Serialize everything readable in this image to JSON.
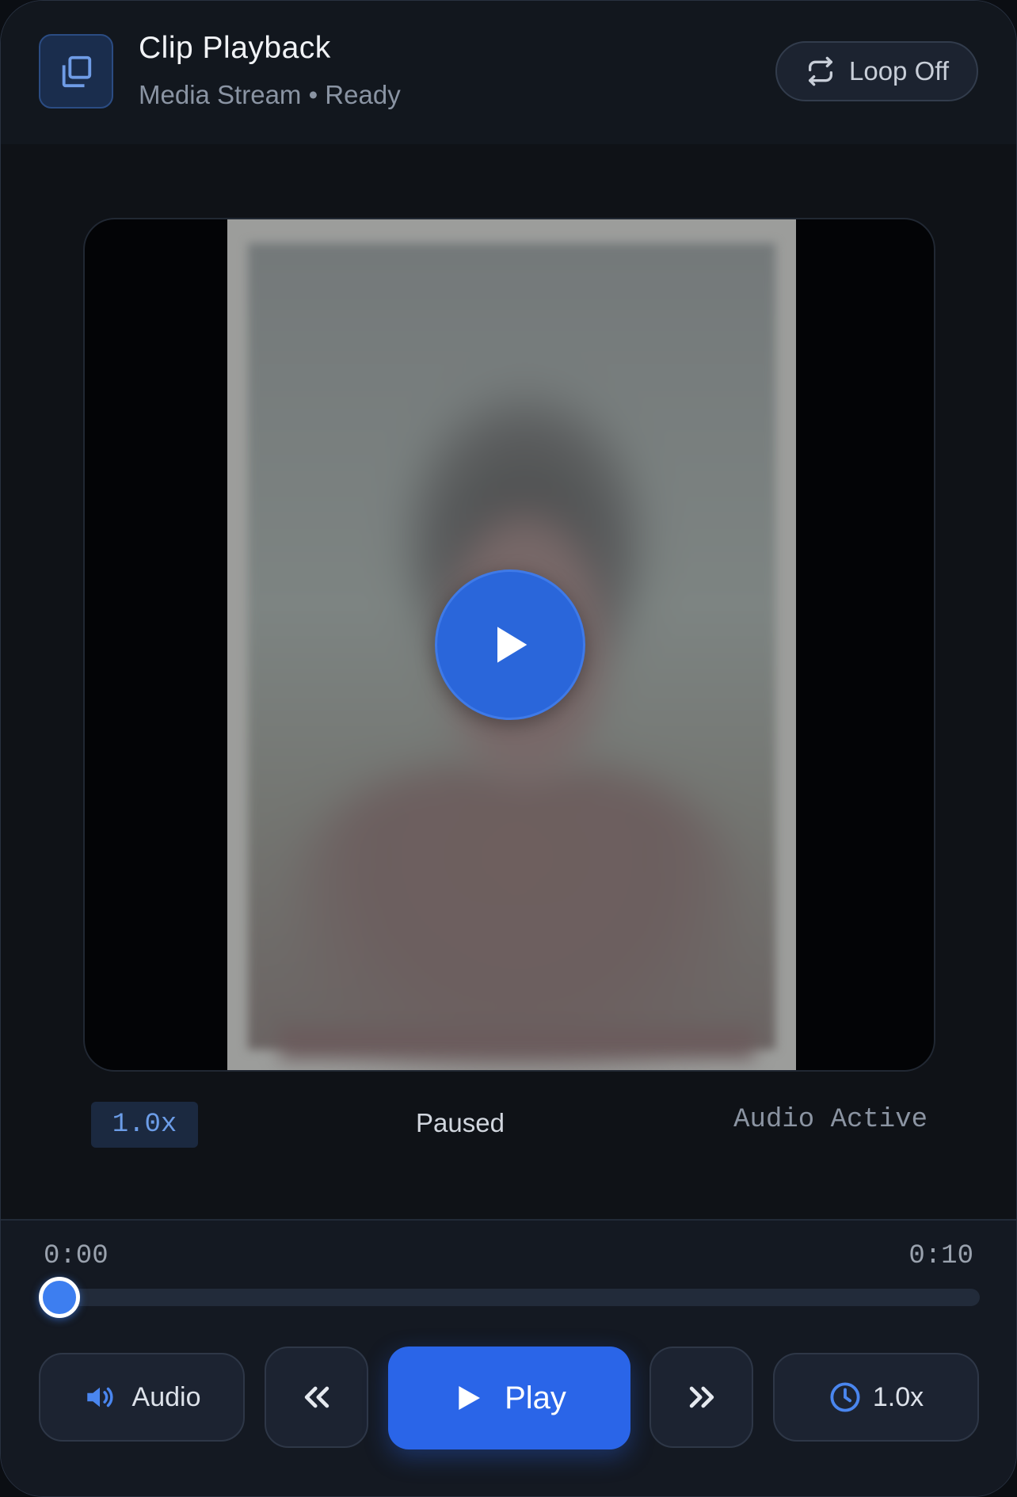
{
  "header": {
    "title": "Clip Playback",
    "subtitle": "Media Stream • Ready",
    "loop_label": "Loop Off"
  },
  "status": {
    "speed": "1.0x",
    "state": "Paused",
    "audio": "Audio Active"
  },
  "timeline": {
    "current": "0:00",
    "duration": "0:10",
    "progress": 0
  },
  "controls": {
    "audio_label": "Audio",
    "play_label": "Play",
    "speed_label": "1.0x"
  },
  "colors": {
    "accent": "#2a65e8",
    "background": "#101419"
  }
}
